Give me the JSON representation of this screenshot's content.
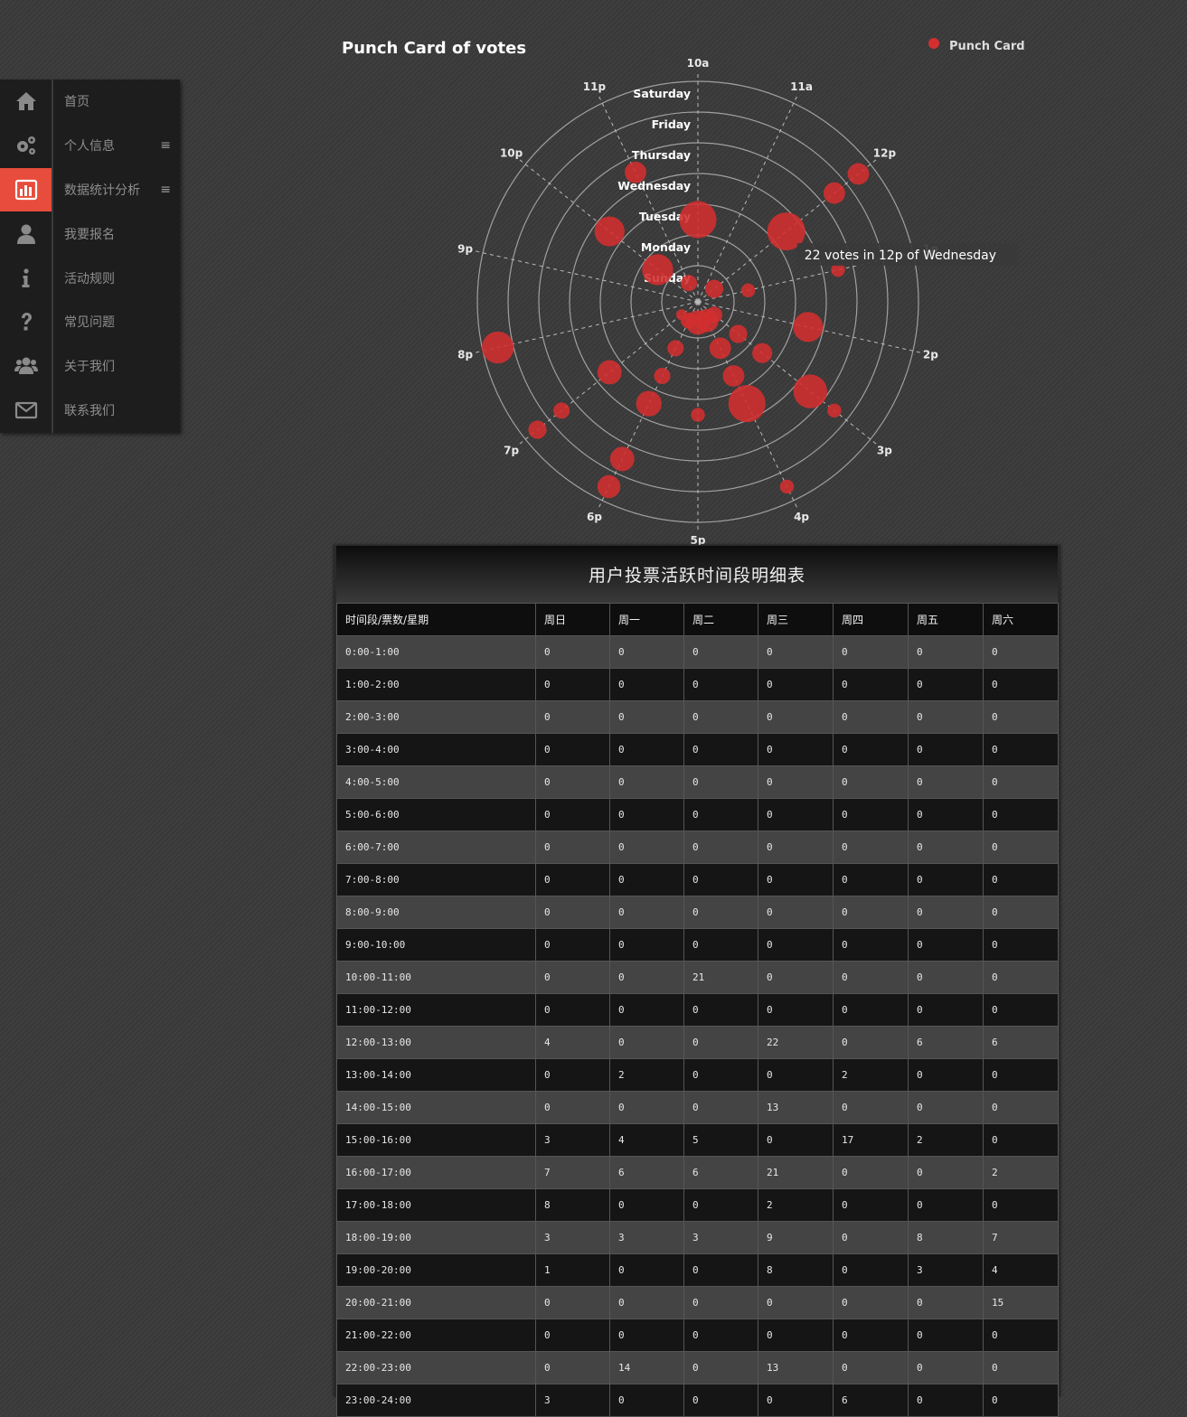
{
  "sidebar": {
    "items": [
      {
        "label": "首页",
        "icon": "home-icon",
        "active": false,
        "menu": false
      },
      {
        "label": "个人信息",
        "icon": "gears-icon",
        "active": false,
        "menu": true
      },
      {
        "label": "数据统计分析",
        "icon": "bar-chart-icon",
        "active": true,
        "menu": true
      },
      {
        "label": "我要报名",
        "icon": "user-icon",
        "active": false,
        "menu": false
      },
      {
        "label": "活动规则",
        "icon": "info-icon",
        "active": false,
        "menu": false
      },
      {
        "label": "常见问题",
        "icon": "question-icon",
        "active": false,
        "menu": false
      },
      {
        "label": "关于我们",
        "icon": "users-icon",
        "active": false,
        "menu": false
      },
      {
        "label": "联系我们",
        "icon": "envelope-icon",
        "active": false,
        "menu": false
      }
    ],
    "menu_glyph": "≡",
    "accent_color": "#e74c3c"
  },
  "chart_data": {
    "type": "scatter",
    "polar": true,
    "title": "Punch Card of votes",
    "legend": {
      "label": "Punch Card",
      "position": "top-right"
    },
    "series_color": "#d32f2f",
    "angle_labels": [
      "10a",
      "11a",
      "12p",
      "1p",
      "2p",
      "3p",
      "4p",
      "5p",
      "6p",
      "7p",
      "8p",
      "9p",
      "10p",
      "11p"
    ],
    "radial_labels": [
      "Sunday",
      "Monday",
      "Tuesday",
      "Wednesday",
      "Thursday",
      "Friday",
      "Saturday"
    ],
    "tooltip": "22 votes in 12p of Wednesday",
    "points": [
      {
        "hour": "10a",
        "day": "Tuesday",
        "votes": 21
      },
      {
        "hour": "12p",
        "day": "Sunday",
        "votes": 4
      },
      {
        "hour": "12p",
        "day": "Wednesday",
        "votes": 22
      },
      {
        "hour": "12p",
        "day": "Friday",
        "votes": 6
      },
      {
        "hour": "12p",
        "day": "Saturday",
        "votes": 6
      },
      {
        "hour": "1p",
        "day": "Monday",
        "votes": 2
      },
      {
        "hour": "1p",
        "day": "Thursday",
        "votes": 2
      },
      {
        "hour": "2p",
        "day": "Wednesday",
        "votes": 13
      },
      {
        "hour": "3p",
        "day": "Sunday",
        "votes": 3
      },
      {
        "hour": "3p",
        "day": "Monday",
        "votes": 4
      },
      {
        "hour": "3p",
        "day": "Tuesday",
        "votes": 5
      },
      {
        "hour": "3p",
        "day": "Thursday",
        "votes": 17
      },
      {
        "hour": "3p",
        "day": "Friday",
        "votes": 2
      },
      {
        "hour": "4p",
        "day": "Sunday",
        "votes": 7
      },
      {
        "hour": "4p",
        "day": "Monday",
        "votes": 6
      },
      {
        "hour": "4p",
        "day": "Tuesday",
        "votes": 6
      },
      {
        "hour": "4p",
        "day": "Wednesday",
        "votes": 21
      },
      {
        "hour": "4p",
        "day": "Saturday",
        "votes": 2
      },
      {
        "hour": "5p",
        "day": "Sunday",
        "votes": 8
      },
      {
        "hour": "5p",
        "day": "Wednesday",
        "votes": 2
      },
      {
        "hour": "6p",
        "day": "Sunday",
        "votes": 3
      },
      {
        "hour": "6p",
        "day": "Monday",
        "votes": 3
      },
      {
        "hour": "6p",
        "day": "Tuesday",
        "votes": 3
      },
      {
        "hour": "6p",
        "day": "Wednesday",
        "votes": 9
      },
      {
        "hour": "6p",
        "day": "Friday",
        "votes": 8
      },
      {
        "hour": "6p",
        "day": "Saturday",
        "votes": 7
      },
      {
        "hour": "7p",
        "day": "Sunday",
        "votes": 1
      },
      {
        "hour": "7p",
        "day": "Wednesday",
        "votes": 8
      },
      {
        "hour": "7p",
        "day": "Friday",
        "votes": 3
      },
      {
        "hour": "7p",
        "day": "Saturday",
        "votes": 4
      },
      {
        "hour": "8p",
        "day": "Saturday",
        "votes": 15
      },
      {
        "hour": "10p",
        "day": "Monday",
        "votes": 14
      },
      {
        "hour": "10p",
        "day": "Wednesday",
        "votes": 13
      },
      {
        "hour": "11p",
        "day": "Sunday",
        "votes": 3
      },
      {
        "hour": "11p",
        "day": "Thursday",
        "votes": 6
      }
    ]
  },
  "table": {
    "title": "用户投票活跃时间段明细表",
    "headers": [
      "时间段/票数/星期",
      "周日",
      "周一",
      "周二",
      "周三",
      "周四",
      "周五",
      "周六"
    ],
    "rows": [
      [
        "0:00-1:00",
        "0",
        "0",
        "0",
        "0",
        "0",
        "0",
        "0"
      ],
      [
        "1:00-2:00",
        "0",
        "0",
        "0",
        "0",
        "0",
        "0",
        "0"
      ],
      [
        "2:00-3:00",
        "0",
        "0",
        "0",
        "0",
        "0",
        "0",
        "0"
      ],
      [
        "3:00-4:00",
        "0",
        "0",
        "0",
        "0",
        "0",
        "0",
        "0"
      ],
      [
        "4:00-5:00",
        "0",
        "0",
        "0",
        "0",
        "0",
        "0",
        "0"
      ],
      [
        "5:00-6:00",
        "0",
        "0",
        "0",
        "0",
        "0",
        "0",
        "0"
      ],
      [
        "6:00-7:00",
        "0",
        "0",
        "0",
        "0",
        "0",
        "0",
        "0"
      ],
      [
        "7:00-8:00",
        "0",
        "0",
        "0",
        "0",
        "0",
        "0",
        "0"
      ],
      [
        "8:00-9:00",
        "0",
        "0",
        "0",
        "0",
        "0",
        "0",
        "0"
      ],
      [
        "9:00-10:00",
        "0",
        "0",
        "0",
        "0",
        "0",
        "0",
        "0"
      ],
      [
        "10:00-11:00",
        "0",
        "0",
        "21",
        "0",
        "0",
        "0",
        "0"
      ],
      [
        "11:00-12:00",
        "0",
        "0",
        "0",
        "0",
        "0",
        "0",
        "0"
      ],
      [
        "12:00-13:00",
        "4",
        "0",
        "0",
        "22",
        "0",
        "6",
        "6"
      ],
      [
        "13:00-14:00",
        "0",
        "2",
        "0",
        "0",
        "2",
        "0",
        "0"
      ],
      [
        "14:00-15:00",
        "0",
        "0",
        "0",
        "13",
        "0",
        "0",
        "0"
      ],
      [
        "15:00-16:00",
        "3",
        "4",
        "5",
        "0",
        "17",
        "2",
        "0"
      ],
      [
        "16:00-17:00",
        "7",
        "6",
        "6",
        "21",
        "0",
        "0",
        "2"
      ],
      [
        "17:00-18:00",
        "8",
        "0",
        "0",
        "2",
        "0",
        "0",
        "0"
      ],
      [
        "18:00-19:00",
        "3",
        "3",
        "3",
        "9",
        "0",
        "8",
        "7"
      ],
      [
        "19:00-20:00",
        "1",
        "0",
        "0",
        "8",
        "0",
        "3",
        "4"
      ],
      [
        "20:00-21:00",
        "0",
        "0",
        "0",
        "0",
        "0",
        "0",
        "15"
      ],
      [
        "21:00-22:00",
        "0",
        "0",
        "0",
        "0",
        "0",
        "0",
        "0"
      ],
      [
        "22:00-23:00",
        "0",
        "14",
        "0",
        "13",
        "0",
        "0",
        "0"
      ],
      [
        "23:00-24:00",
        "3",
        "0",
        "0",
        "0",
        "6",
        "0",
        "0"
      ]
    ]
  }
}
